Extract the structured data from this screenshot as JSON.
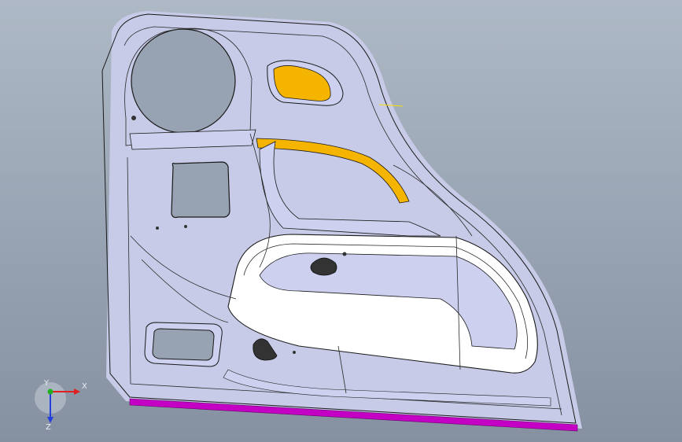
{
  "viewport": {
    "background_top": "#aeb9c6",
    "background_bottom": "#8591a1"
  },
  "model": {
    "panel_fill": "#ffffff",
    "shade_fill": "#cdd0ef",
    "highlight_fill": "#f5b400",
    "trim_fill": "#c400c4"
  },
  "triad": {
    "x_label": "X",
    "y_label": "Y",
    "z_label": "Z",
    "x_color": "#e02020",
    "y_color": "#20b020",
    "z_color": "#2040e0"
  }
}
